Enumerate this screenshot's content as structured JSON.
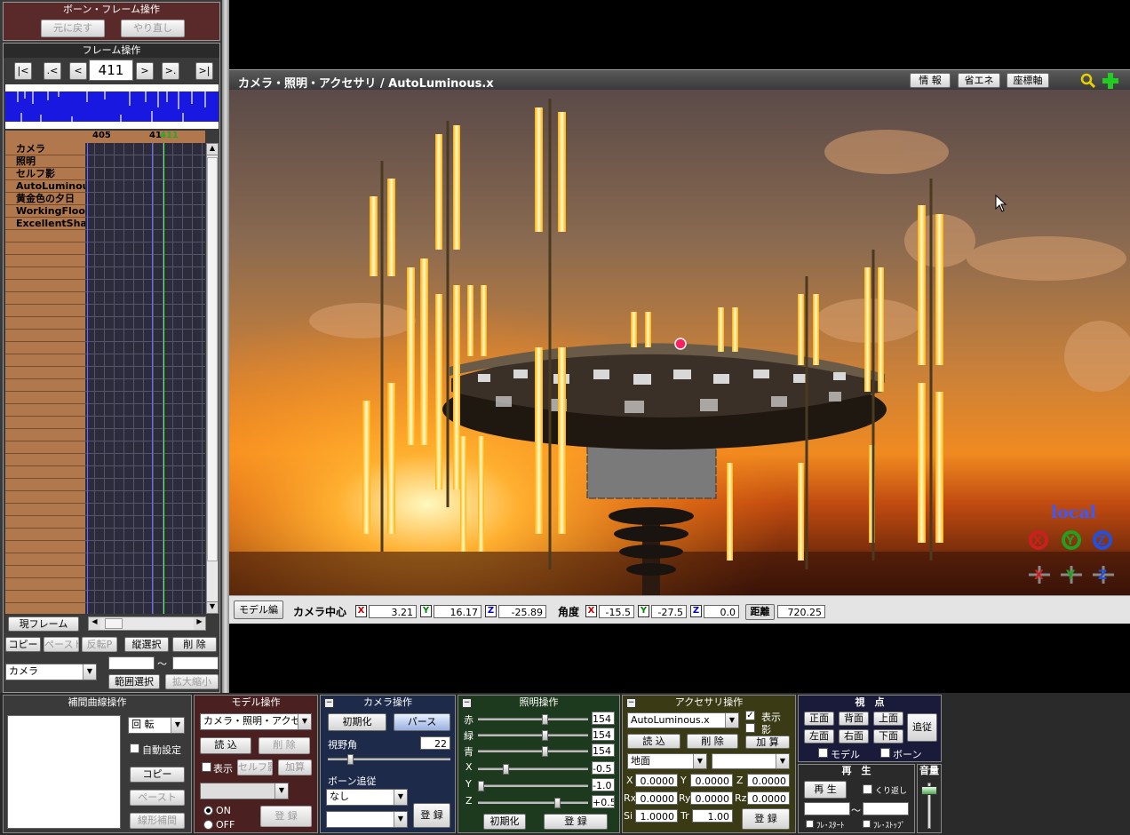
{
  "bone_panel": {
    "title": "ボーン・フレーム操作",
    "undo": "元に戻す",
    "redo": "やり直し"
  },
  "frame_panel": {
    "title": "フレーム操作",
    "current_frame": "411",
    "nav": {
      "first": "|<",
      "prev_key": ".<",
      "prev": "<",
      "next": ">",
      "next_key": ">.",
      "last": ">|"
    },
    "ruler": {
      "left": "405",
      "right": "41",
      "cursor": "411"
    },
    "tracks": [
      "カメラ",
      "照明",
      "セルフ影",
      "AutoLuminous",
      "黄金色の夕日",
      "WorkingFloor",
      "ExcellentSha"
    ],
    "current_frame_btn": "現フレーム",
    "copy": "コピー",
    "paste": "ペースト",
    "flip_paste": "反転P",
    "vertical_select": "縦選択",
    "delete": "削 除",
    "target_select": "カメラ",
    "tilde": "～",
    "range_select": "範囲選択",
    "scale": "拡大縮小"
  },
  "viewport": {
    "title": "カメラ・照明・アクセサリ / AutoLuminous.x",
    "info": "情 報",
    "eco": "省エネ",
    "axes": "座標軸",
    "local": "local",
    "gizmo_rot": [
      "X",
      "Y",
      "Z"
    ],
    "gizmo_move": [
      "X",
      "Y",
      "Z"
    ]
  },
  "statusbar": {
    "model_edit": "モデル編",
    "camera_center": "カメラ中心",
    "cx": "3.21",
    "cy": "16.17",
    "cz": "-25.89",
    "angle": "角度",
    "ax": "-15.5",
    "ay": "-27.5",
    "az": "0.0",
    "distance": "距離",
    "dist": "720.25",
    "axis_x": "X",
    "axis_y": "Y",
    "axis_z": "Z"
  },
  "interp_panel": {
    "title": "補間曲線操作",
    "mode": "回 転",
    "auto": "自動設定",
    "copy": "コピー",
    "paste": "ペースト",
    "linear": "線形補間"
  },
  "model_panel": {
    "title": "モデル操作",
    "model": "カメラ・照明・アクセサリ",
    "load": "読 込",
    "delete": "削 除",
    "show": "表示",
    "self_shadow": "セルフ影",
    "add": "加算",
    "on": "ON",
    "off": "OFF",
    "register": "登 録"
  },
  "camera_panel": {
    "title": "カメラ操作",
    "init": "初期化",
    "perspective": "パース",
    "fov_label": "視野角",
    "fov": "22",
    "bone_follow": "ボーン追従",
    "follow_target": "なし",
    "register": "登 録"
  },
  "light_panel": {
    "title": "照明操作",
    "r_label": "赤",
    "g_label": "緑",
    "b_label": "青",
    "r": "154",
    "g": "154",
    "b": "154",
    "x_label": "X",
    "y_label": "Y",
    "z_label": "Z",
    "x": "-0.5",
    "y": "-1.0",
    "z": "+0.5",
    "init": "初期化",
    "register": "登 録"
  },
  "accessory_panel": {
    "title": "アクセサリ操作",
    "name": "AutoLuminous.x",
    "show": "表示",
    "shadow": "影",
    "load": "読 込",
    "delete": "削 除",
    "add": "加 算",
    "parent": "地面",
    "x_label": "X",
    "y_label": "Y",
    "z_label": "Z",
    "rx_label": "Rx",
    "ry_label": "Ry",
    "rz_label": "Rz",
    "si_label": "Si",
    "tr_label": "Tr",
    "x": "0.0000",
    "y": "0.0000",
    "z": "0.0000",
    "rx": "0.0000",
    "ry": "0.0000",
    "rz": "0.0000",
    "si": "1.0000",
    "tr": "1.00",
    "register": "登 録"
  },
  "view_panel": {
    "title": "視　点",
    "front": "正面",
    "back": "背面",
    "top": "上面",
    "left": "左面",
    "right": "右面",
    "bottom": "下面",
    "follow": "追従",
    "model": "モデル",
    "bone": "ボーン"
  },
  "play_panel": {
    "title": "再　生",
    "play": "再 生",
    "repeat": "くり返し",
    "tilde": "～",
    "frame_start": "ﾌﾚ･ｽﾀｰﾄ",
    "frame_stop": "ﾌﾚ･ｽﾄｯﾌﾟ"
  },
  "volume_panel": {
    "title": "音量"
  },
  "colors": {
    "panel_title_bg": "#5a2a2a",
    "track_bg": "#b0784c",
    "timeline_bg": "#2a2a3a",
    "viewport_title": "#3a3a3a",
    "camera_panel": "#1e2a4a",
    "light_panel": "#1e3a1e",
    "accessory_panel": "#3a3a14",
    "view_panel": "#1a1a3a"
  }
}
